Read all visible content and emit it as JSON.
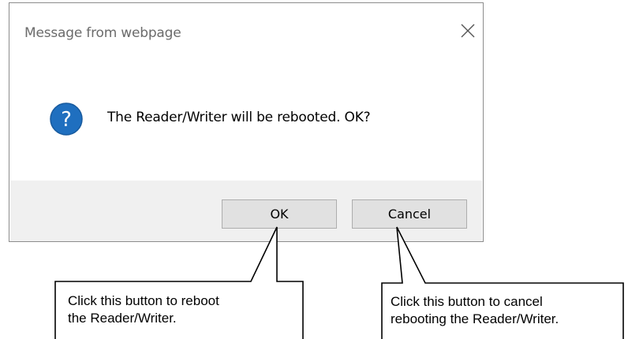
{
  "dialog": {
    "title": "Message from webpage",
    "message": "The Reader/Writer will be rebooted. OK?",
    "icon": "question-icon",
    "buttons": {
      "ok_label": "OK",
      "cancel_label": "Cancel"
    }
  },
  "callouts": {
    "ok_note_line1": "Click this button to reboot",
    "ok_note_line2": "the Reader/Writer.",
    "cancel_note_line1": "Click this button to cancel",
    "cancel_note_line2": "rebooting the Reader/Writer."
  },
  "colors": {
    "icon_blue": "#1f6fbf",
    "footer_gray": "#f0f0f0",
    "button_gray": "#e1e1e1"
  }
}
